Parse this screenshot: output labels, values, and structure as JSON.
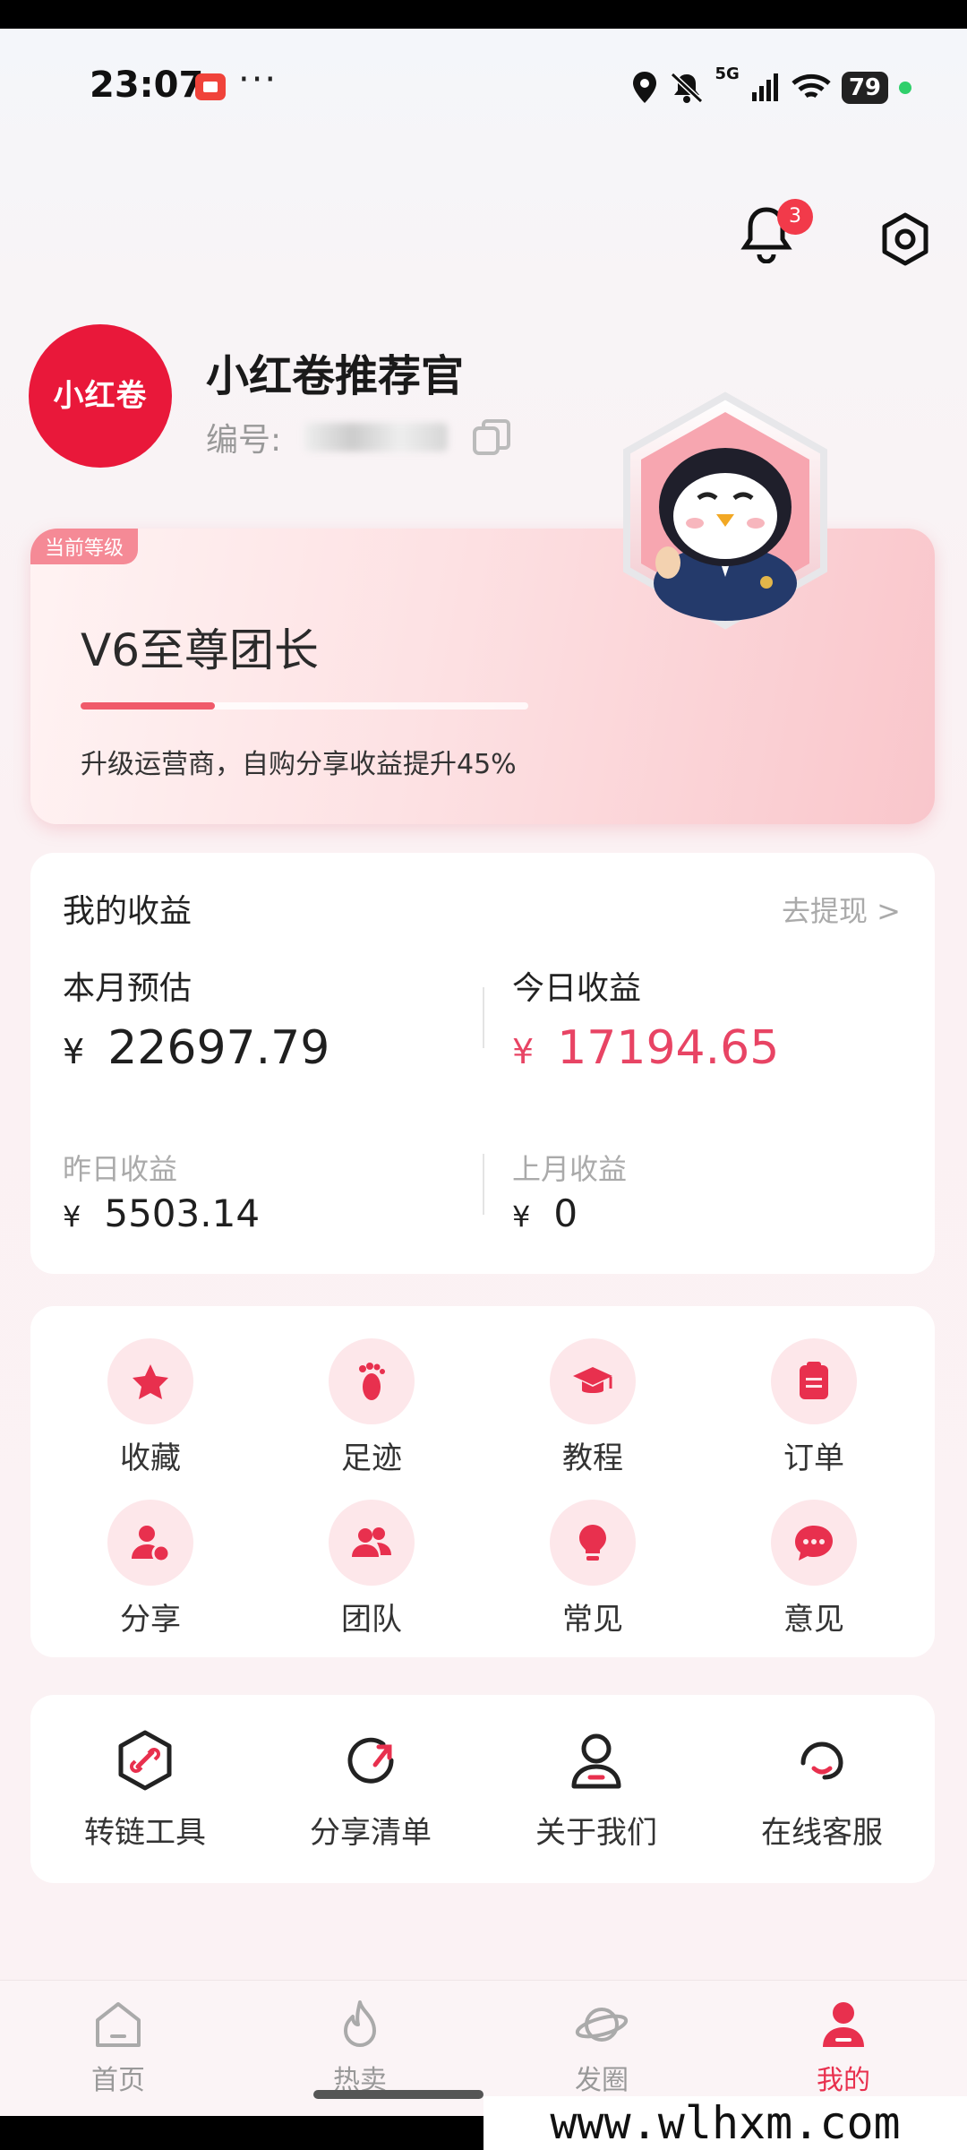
{
  "status_bar": {
    "time": "23:07",
    "dots": "···",
    "network": "5G",
    "battery": "79"
  },
  "header": {
    "notification_count": "3"
  },
  "profile": {
    "avatar_text": "小红卷",
    "nickname": "小红卷推荐官",
    "uid_label": "编号:"
  },
  "level": {
    "tag": "当前等级",
    "title": "V6至尊团长",
    "progress_percent": 30,
    "description": "升级运营商，自购分享收益提升45%"
  },
  "earnings": {
    "title": "我的收益",
    "withdraw": "去提现 >",
    "currency": "¥",
    "month_estimate_label": "本月预估",
    "month_estimate_value": "22697.79",
    "today_label": "今日收益",
    "today_value": "17194.65",
    "yesterday_label": "昨日收益",
    "yesterday_value": "5503.14",
    "last_month_label": "上月收益",
    "last_month_value": "0"
  },
  "functions": [
    {
      "label": "收藏",
      "icon": "star-icon"
    },
    {
      "label": "足迹",
      "icon": "footprint-icon"
    },
    {
      "label": "教程",
      "icon": "graduation-cap-icon"
    },
    {
      "label": "订单",
      "icon": "clipboard-icon"
    },
    {
      "label": "分享",
      "icon": "user-share-icon"
    },
    {
      "label": "团队",
      "icon": "team-icon"
    },
    {
      "label": "常见",
      "icon": "lightbulb-icon"
    },
    {
      "label": "意见",
      "icon": "chat-bubble-icon"
    }
  ],
  "tools": [
    {
      "label": "转链工具",
      "icon": "link-hexagon-icon"
    },
    {
      "label": "分享清单",
      "icon": "share-circle-icon"
    },
    {
      "label": "关于我们",
      "icon": "person-icon"
    },
    {
      "label": "在线客服",
      "icon": "headset-icon"
    }
  ],
  "bottom_nav": [
    {
      "label": "首页",
      "icon": "home-icon"
    },
    {
      "label": "热卖",
      "icon": "flame-icon"
    },
    {
      "label": "发圈",
      "icon": "planet-icon"
    },
    {
      "label": "我的",
      "icon": "profile-icon",
      "active": true
    }
  ],
  "colors": {
    "accent": "#e8304e",
    "today_value": "#e84464"
  },
  "watermark": "www.wlhxm.com"
}
